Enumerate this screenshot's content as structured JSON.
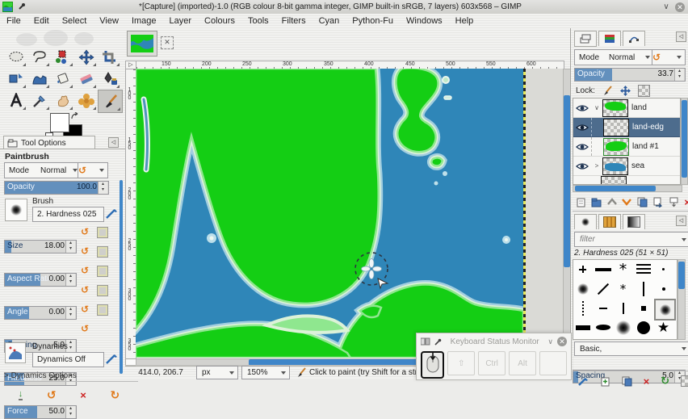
{
  "window": {
    "title": "*[Capture] (imported)-1.0 (RGB colour 8-bit gamma integer, GIMP built-in sRGB, 7 layers) 603x568 – GIMP",
    "shade_glyph": "∨",
    "close_glyph": "✕"
  },
  "menubar": {
    "items": [
      "File",
      "Edit",
      "Select",
      "View",
      "Image",
      "Layer",
      "Colours",
      "Tools",
      "Filters",
      "Cyan",
      "Python-Fu",
      "Windows",
      "Help"
    ]
  },
  "toolbox": {
    "tools": [
      "Ellipse Select",
      "Free Select",
      "Select by Colour",
      "Move",
      "Crop",
      "Unified Transform",
      "Warp Transform",
      "Bucket Fill",
      "Eraser",
      "Ink",
      "Text",
      "Colour Picker",
      "Smudge",
      "MyPaint Brush",
      "Paintbrush"
    ]
  },
  "tool_options": {
    "tab_label": "Tool Options",
    "tool_name": "Paintbrush",
    "mode_label": "Mode",
    "mode_value": "Normal",
    "opacity": {
      "label": "Opacity",
      "value": "100.0"
    },
    "brush": {
      "label": "Brush",
      "value": "2. Hardness 025"
    },
    "sliders": [
      {
        "label": "Size",
        "value": "18.00"
      },
      {
        "label": "Aspect Ratio",
        "value": "0.00"
      },
      {
        "label": "Angle",
        "value": "0.00"
      },
      {
        "label": "Spacing",
        "value": "5.0"
      },
      {
        "label": "Hardness",
        "value": "25.0"
      },
      {
        "label": "Force",
        "value": "50.0"
      }
    ],
    "dynamics": {
      "label": "Dynamics",
      "value": "Dynamics Off"
    },
    "dynamics_options_label": "Dynamics Options"
  },
  "canvas": {
    "ruler_h_labels": [
      "150",
      "200",
      "250",
      "300",
      "350",
      "400",
      "450",
      "500",
      "550",
      "600"
    ],
    "ruler_v_labels": [
      "100",
      "150",
      "200",
      "250",
      "300",
      "350"
    ],
    "colors": {
      "sea": "#2f86b8",
      "land": "#14ce14",
      "coast_rim": "#ddf3d8",
      "coast_halo": "#aed3e2"
    }
  },
  "statusbar": {
    "position": "414.0, 206.7",
    "unit": "px",
    "zoom": "150%",
    "hint": "Click to paint (try Shift for a straight line, Ctrl to pick a"
  },
  "layers_panel": {
    "mode_label": "Mode",
    "mode_value": "Normal",
    "opacity_label": "Opacity",
    "opacity_value": "33.7",
    "lock_label": "Lock:",
    "layers": [
      {
        "name": "land"
      },
      {
        "name": "land-edg"
      },
      {
        "name": "land #1"
      },
      {
        "name": "sea"
      }
    ]
  },
  "brushes_panel": {
    "filter_placeholder": "filter",
    "selected_brush_label": "2. Hardness 025 (51 × 51)",
    "category": "Basic,",
    "spacing_label": "Spacing",
    "spacing_value": "5.0"
  },
  "keyboard_monitor": {
    "title": "Keyboard Status Monitor",
    "keys": [
      {
        "label": "⇧"
      },
      {
        "label": "Ctrl"
      },
      {
        "label": "Alt"
      },
      {
        "label": ""
      }
    ]
  }
}
